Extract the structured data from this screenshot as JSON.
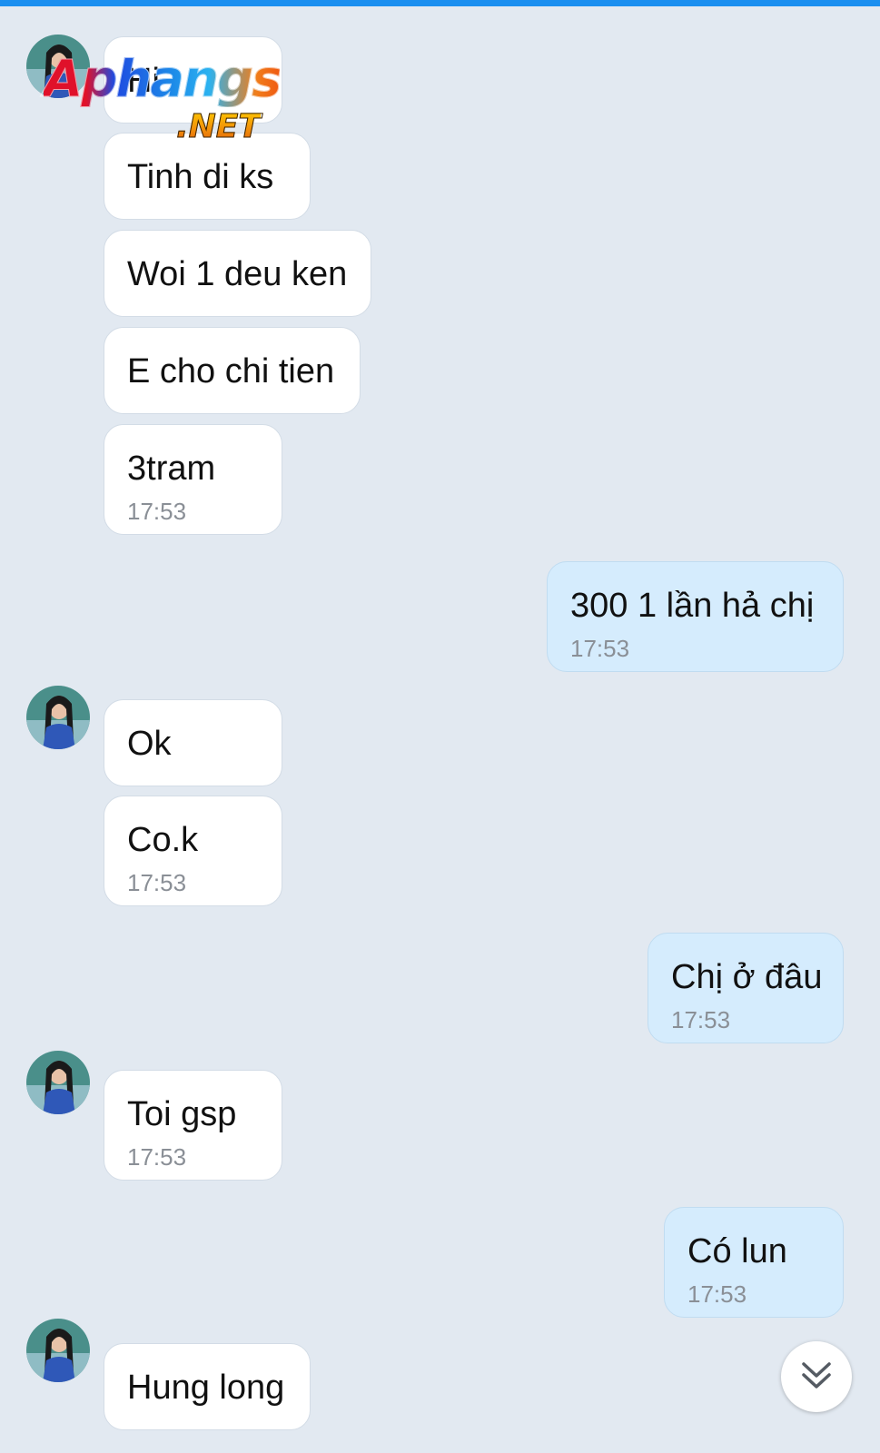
{
  "colors": {
    "background": "#e2e9f1",
    "incoming_bubble": "#ffffff",
    "outgoing_bubble": "#d5ecfd",
    "time_text": "#8a8f96",
    "top_bar": "#1a8ff0"
  },
  "watermark": {
    "main": "Aphangs",
    "sub": ".NET"
  },
  "messages": [
    {
      "direction": "incoming",
      "text": "Hi",
      "time": ""
    },
    {
      "direction": "incoming",
      "text": "Tinh di ks",
      "time": ""
    },
    {
      "direction": "incoming",
      "text": "Woi 1 deu ken",
      "time": ""
    },
    {
      "direction": "incoming",
      "text": "E cho chi tien",
      "time": ""
    },
    {
      "direction": "incoming",
      "text": "3tram",
      "time": "17:53"
    },
    {
      "direction": "outgoing",
      "text": "300 1 lần hả chị",
      "time": "17:53"
    },
    {
      "direction": "incoming",
      "text": "Ok",
      "time": ""
    },
    {
      "direction": "incoming",
      "text": "Co.k",
      "time": "17:53"
    },
    {
      "direction": "outgoing",
      "text": "Chị ở đâu",
      "time": "17:53"
    },
    {
      "direction": "incoming",
      "text": "Toi gsp",
      "time": "17:53"
    },
    {
      "direction": "outgoing",
      "text": "Có lun",
      "time": "17:53"
    },
    {
      "direction": "incoming",
      "text": "Hung long",
      "time": ""
    }
  ],
  "avatar_icon": "contact-avatar",
  "scroll_button_icon": "double-chevron-down-icon"
}
